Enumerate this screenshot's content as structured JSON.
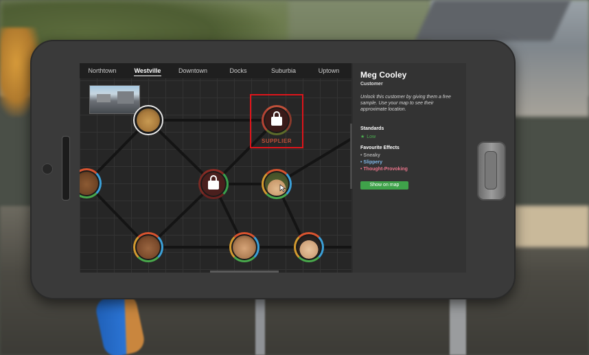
{
  "tabs": [
    "Northtown",
    "Westville",
    "Downtown",
    "Docks",
    "Suburbia",
    "Uptown"
  ],
  "active_tab": "Westville",
  "supplier_label": "SUPPLIER",
  "customer": {
    "name": "Meg Cooley",
    "role": "Customer",
    "description": "Unlock this customer by giving them a free sample. Use your map to see their approximate location.",
    "standards_heading": "Standards",
    "standards_value": "Low",
    "favourite_heading": "Favourite Effects",
    "favourites": [
      "Sneaky",
      "Slippery",
      "Thought-Provoking"
    ],
    "favourite_colors": [
      "#a8a8a8",
      "#7fb6e6",
      "#e8748a"
    ],
    "show_button": "Show on map"
  },
  "colors": {
    "accent_green": "#3fa24a",
    "highlight_red": "#e0141a",
    "supplier_red": "#c0503a"
  },
  "icons": [
    "lock-icon",
    "star-icon",
    "cursor-icon"
  ]
}
